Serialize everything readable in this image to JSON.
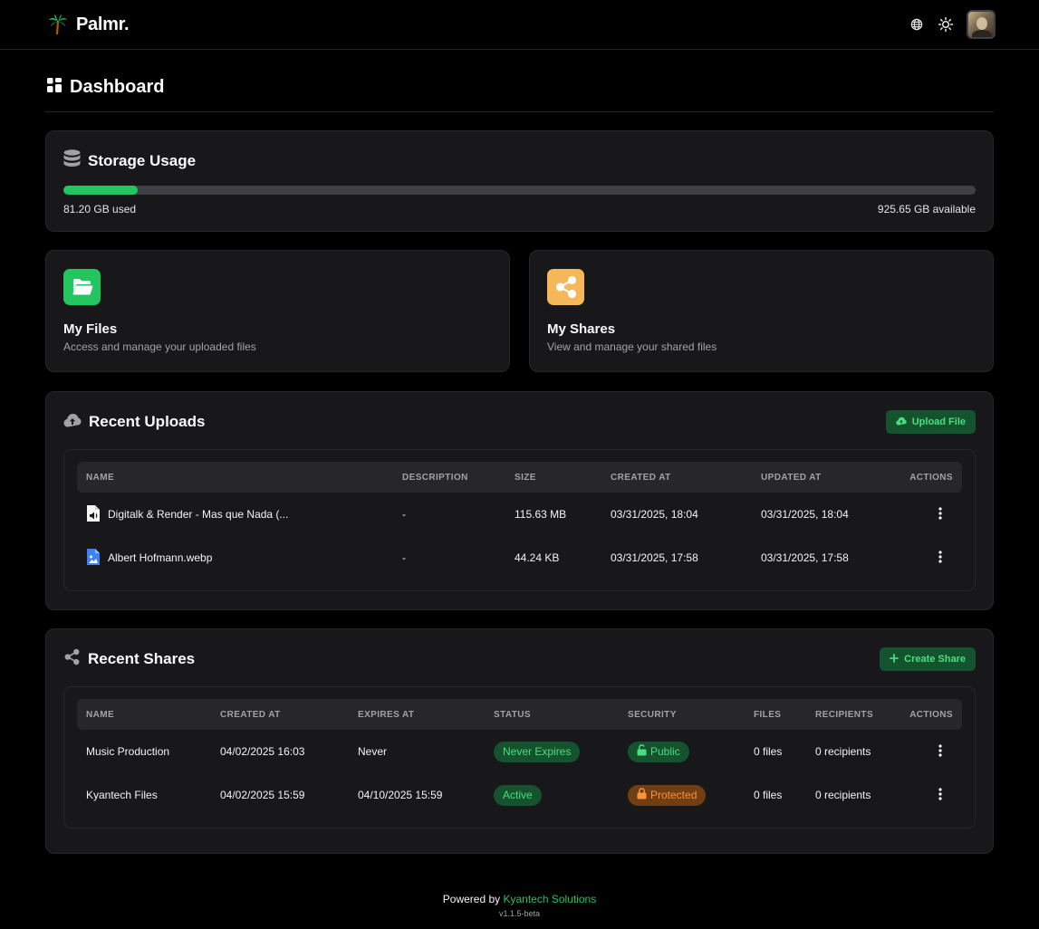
{
  "app": {
    "name": "Palmr."
  },
  "page": {
    "title": "Dashboard"
  },
  "storage": {
    "title": "Storage Usage",
    "used_label": "81.20 GB used",
    "available_label": "925.65 GB available",
    "used_fraction": 0.081
  },
  "quick_links": [
    {
      "title": "My Files",
      "description": "Access and manage your uploaded files",
      "color": "#22c55e"
    },
    {
      "title": "My Shares",
      "description": "View and manage your shared files",
      "color": "#f6b75a"
    }
  ],
  "uploads": {
    "title": "Recent Uploads",
    "button_label": "Upload File",
    "columns": [
      "NAME",
      "DESCRIPTION",
      "SIZE",
      "CREATED AT",
      "UPDATED AT",
      "ACTIONS"
    ],
    "rows": [
      {
        "icon": "audio-file-icon",
        "name": "Digitalk & Render - Mas que Nada (...",
        "description": "-",
        "size": "115.63 MB",
        "created": "03/31/2025, 18:04",
        "updated": "03/31/2025, 18:04"
      },
      {
        "icon": "image-file-icon",
        "name": "Albert Hofmann.webp",
        "description": "-",
        "size": "44.24 KB",
        "created": "03/31/2025, 17:58",
        "updated": "03/31/2025, 17:58"
      }
    ]
  },
  "shares": {
    "title": "Recent Shares",
    "button_label": "Create Share",
    "columns": [
      "NAME",
      "CREATED AT",
      "EXPIRES AT",
      "STATUS",
      "SECURITY",
      "FILES",
      "RECIPIENTS",
      "ACTIONS"
    ],
    "rows": [
      {
        "name": "Music Production",
        "created": "04/02/2025 16:03",
        "expires": "Never",
        "status": "Never Expires",
        "security": "Public",
        "files": "0 files",
        "recipients": "0 recipients"
      },
      {
        "name": "Kyantech Files",
        "created": "04/02/2025 15:59",
        "expires": "04/10/2025 15:59",
        "status": "Active",
        "security": "Protected",
        "files": "0 files",
        "recipients": "0 recipients"
      }
    ]
  },
  "footer": {
    "powered_by": "Powered by",
    "company": "Kyantech Solutions",
    "version": "v1.1.5-beta"
  },
  "colors": {
    "accent": "#22c55e",
    "warning": "#fb923c",
    "background": "#000000",
    "card": "#18181b"
  }
}
